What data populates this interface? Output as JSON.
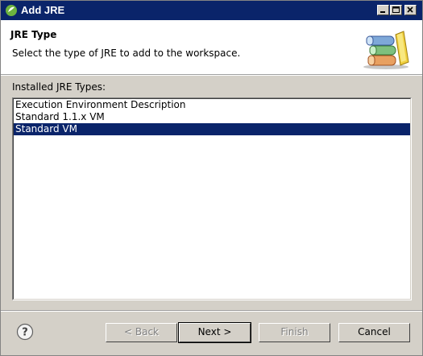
{
  "window": {
    "title": "Add JRE"
  },
  "header": {
    "title": "JRE Type",
    "description": "Select the type of JRE to add to the workspace."
  },
  "list": {
    "label": "Installed JRE Types:",
    "items": [
      {
        "label": "Execution Environment Description",
        "selected": false
      },
      {
        "label": "Standard 1.1.x VM",
        "selected": false
      },
      {
        "label": "Standard VM",
        "selected": true
      }
    ]
  },
  "buttons": {
    "back": "< Back",
    "next": "Next >",
    "finish": "Finish",
    "cancel": "Cancel"
  },
  "colors": {
    "titlebar": "#0a246a",
    "selection": "#0a246a",
    "face": "#d4d0c8"
  }
}
